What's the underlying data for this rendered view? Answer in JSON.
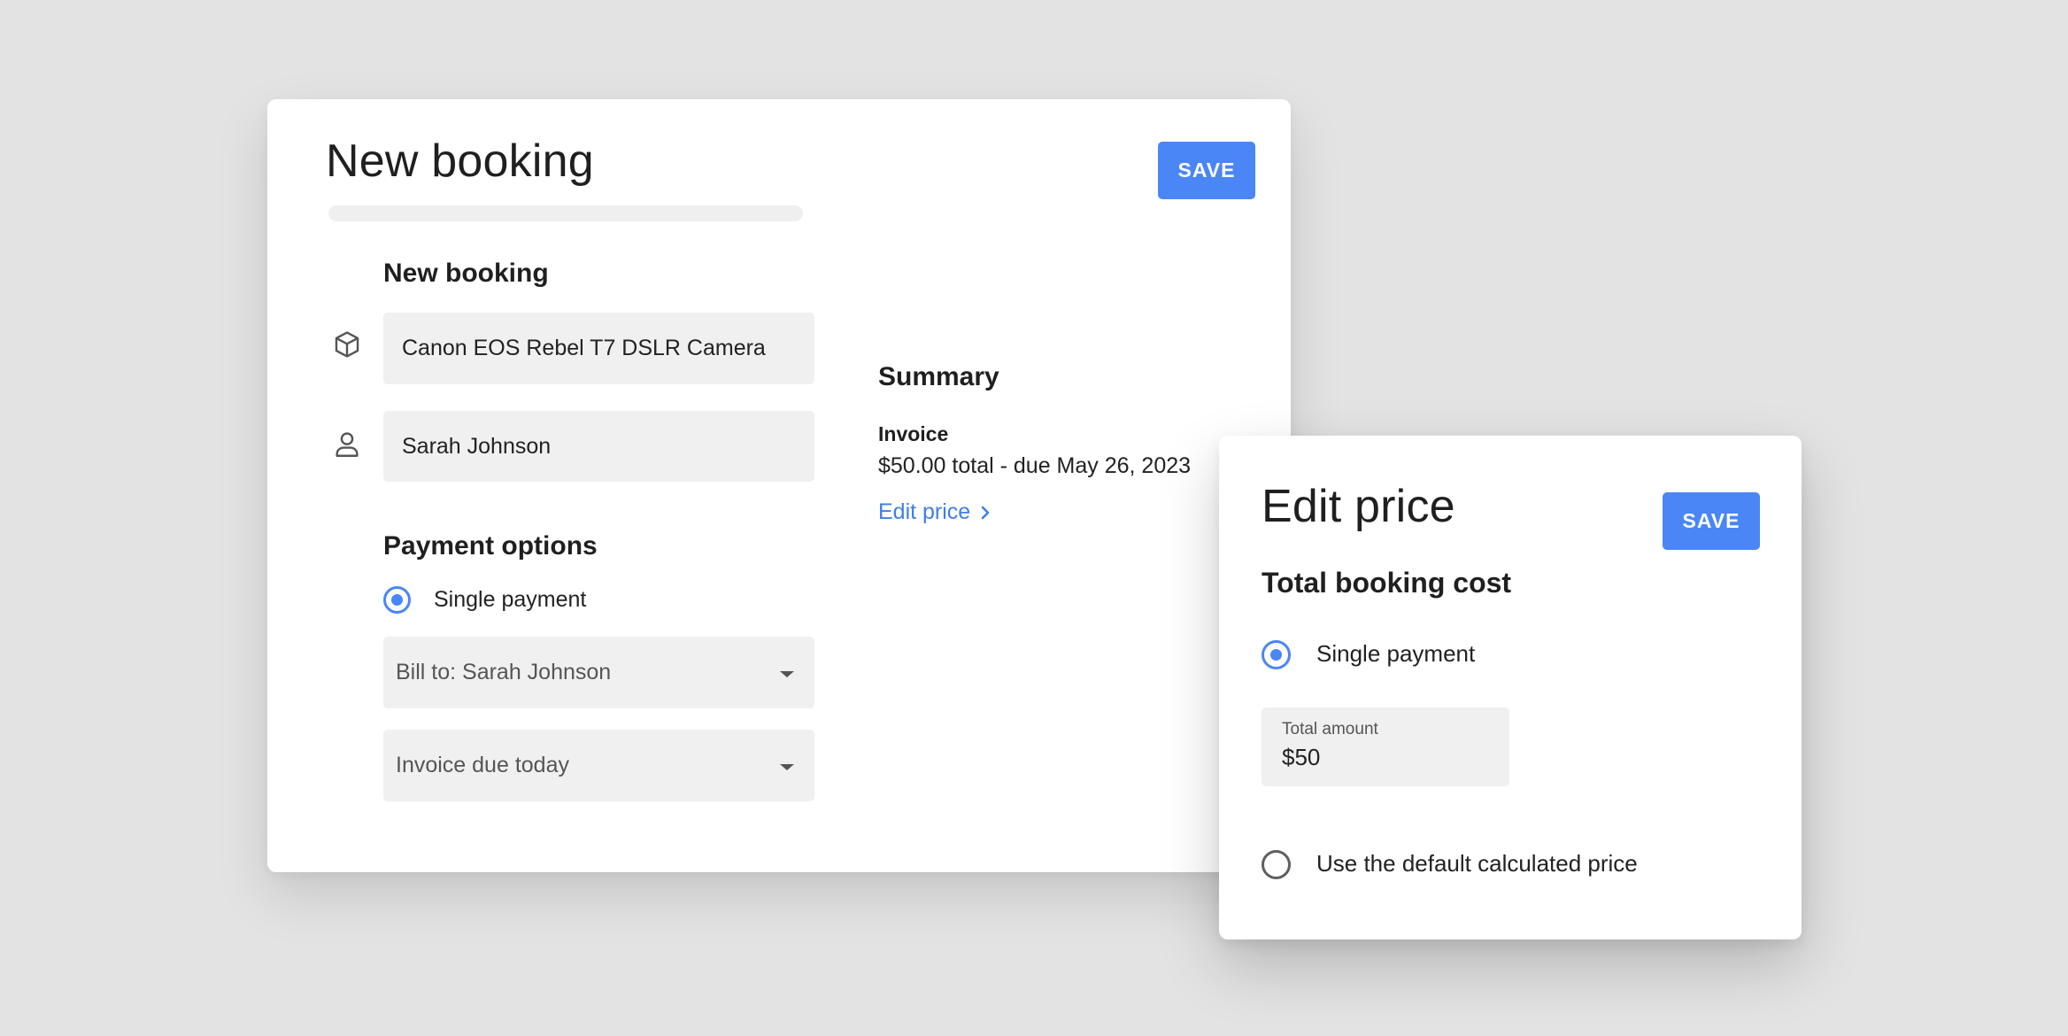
{
  "booking_card": {
    "title": "New booking",
    "save_label": "SAVE",
    "section_title": "New booking",
    "item_value": "Canon EOS Rebel T7 DSLR Camera",
    "customer_value": "Sarah Johnson",
    "payment_title": "Payment options",
    "payment_option": "Single payment",
    "bill_to": "Bill to: Sarah Johnson",
    "invoice_due": "Invoice due today",
    "summary": {
      "title": "Summary",
      "invoice_label": "Invoice",
      "invoice_detail": "$50.00 total - due May 26, 2023",
      "edit_price_label": "Edit price"
    }
  },
  "price_card": {
    "title": "Edit price",
    "save_label": "SAVE",
    "section_title": "Total booking cost",
    "option_single": "Single payment",
    "amount_label": "Total amount",
    "amount_value": "$50",
    "option_default": "Use the default calculated price"
  },
  "colors": {
    "accent": "#4a86f5",
    "link": "#3f7ee8",
    "field_bg": "#f0f0f0",
    "page_bg": "#e3e3e3"
  },
  "icons": {
    "item": "box-icon",
    "customer": "person-icon",
    "dropdown": "caret-down-icon",
    "link": "chevron-right-icon"
  }
}
